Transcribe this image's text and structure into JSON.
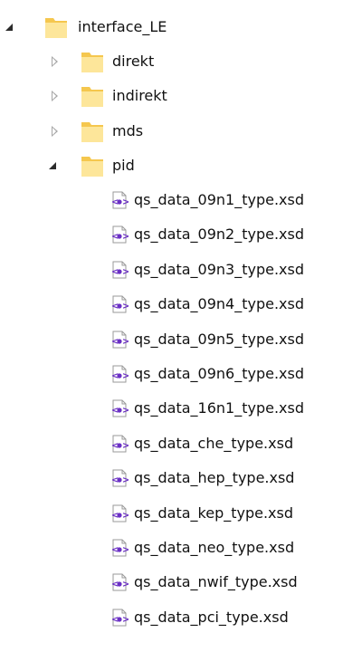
{
  "tree": {
    "root": {
      "label": "interface_LE",
      "expanded": true
    },
    "folders": [
      {
        "label": "direkt",
        "expanded": false
      },
      {
        "label": "indirekt",
        "expanded": false
      },
      {
        "label": "mds",
        "expanded": false
      },
      {
        "label": "pid",
        "expanded": true
      }
    ],
    "files": [
      {
        "label": "qs_data_09n1_type.xsd"
      },
      {
        "label": "qs_data_09n2_type.xsd"
      },
      {
        "label": "qs_data_09n3_type.xsd"
      },
      {
        "label": "qs_data_09n4_type.xsd"
      },
      {
        "label": "qs_data_09n5_type.xsd"
      },
      {
        "label": "qs_data_09n6_type.xsd"
      },
      {
        "label": "qs_data_16n1_type.xsd"
      },
      {
        "label": "qs_data_che_type.xsd"
      },
      {
        "label": "qs_data_hep_type.xsd"
      },
      {
        "label": "qs_data_kep_type.xsd"
      },
      {
        "label": "qs_data_neo_type.xsd"
      },
      {
        "label": "qs_data_nwif_type.xsd"
      },
      {
        "label": "qs_data_pci_type.xsd"
      }
    ]
  },
  "colors": {
    "folder": "#f5c74e",
    "folder_light": "#fde69a",
    "xsd_icon": "#6a2fc4",
    "text": "#111111"
  },
  "icons": {
    "folder": "folder-icon",
    "file": "xsd-file-icon",
    "expanded": "expanded-arrow-icon",
    "collapsed": "collapsed-arrow-icon"
  }
}
